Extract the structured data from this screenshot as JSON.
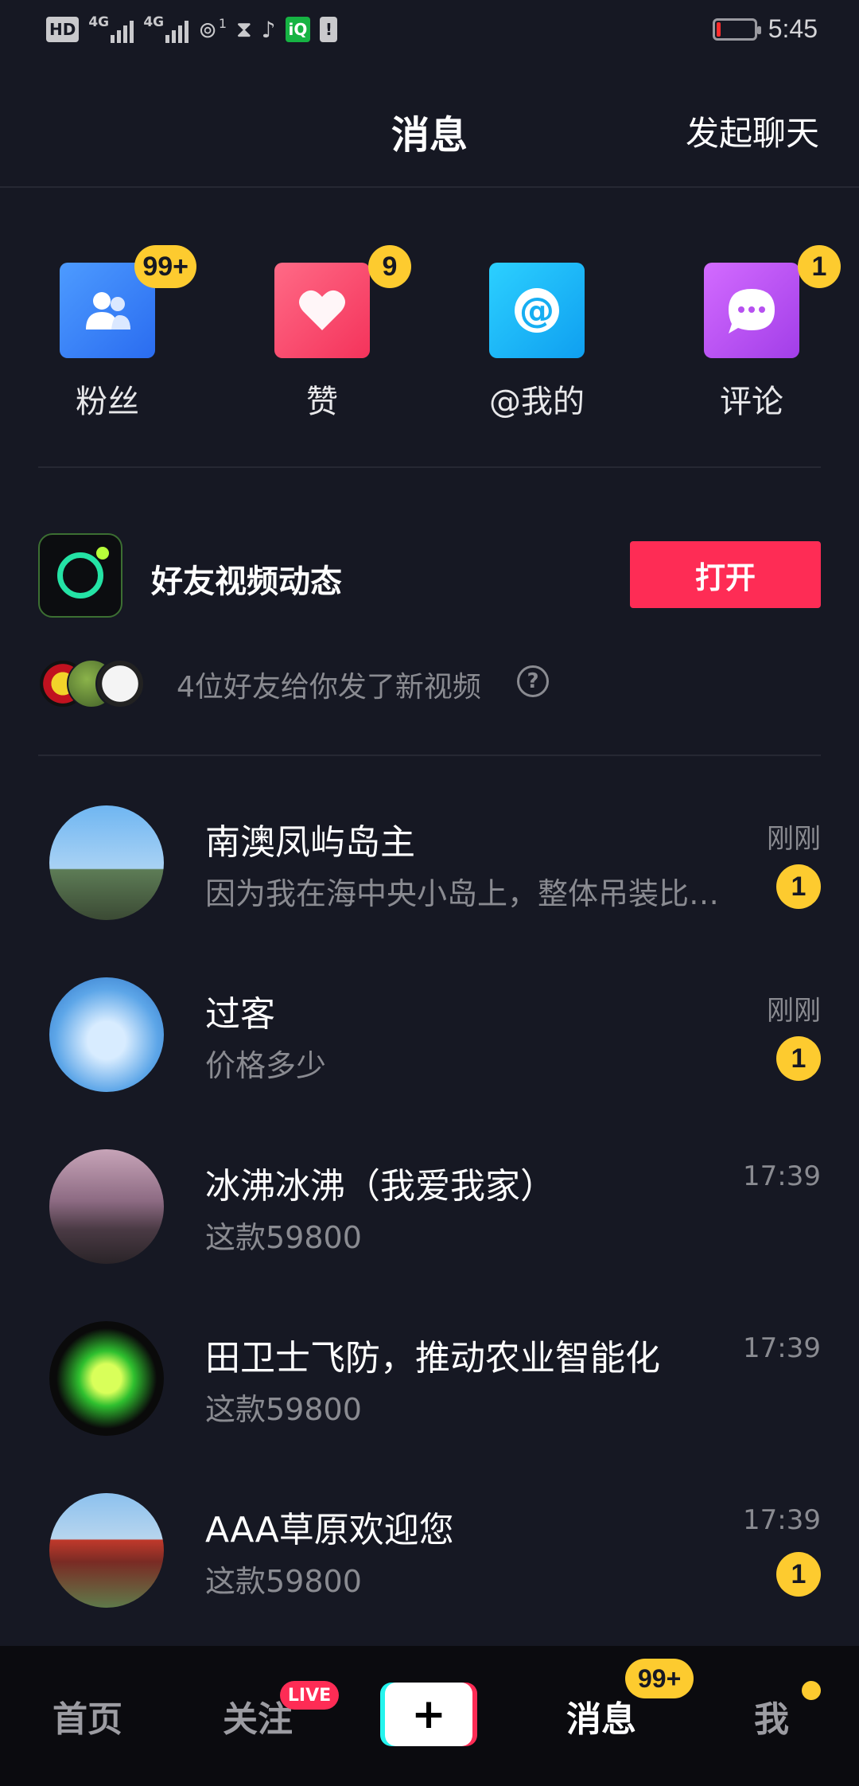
{
  "status_bar": {
    "hd": "HD",
    "net1": "4G",
    "net2": "4G",
    "hotspot_count": "1",
    "time": "5:45",
    "colors": {
      "battery_low": "#ff2d2d"
    }
  },
  "header": {
    "title": "消息",
    "action": "发起聊天"
  },
  "categories": [
    {
      "label": "粉丝",
      "badge": "99+",
      "icon": "fans-icon",
      "color": "#3a86f6"
    },
    {
      "label": "赞",
      "badge": "9",
      "icon": "heart-icon",
      "color": "#fd4a6e"
    },
    {
      "label": "@我的",
      "badge": "",
      "icon": "at-icon",
      "color": "#1ab5f5"
    },
    {
      "label": "评论",
      "badge": "1",
      "icon": "comment-icon",
      "color": "#b650f0"
    }
  ],
  "friends_video": {
    "title": "好友视频动态",
    "button": "打开",
    "subtitle": "4位好友给你发了新视频",
    "help": "?"
  },
  "conversations": [
    {
      "name": "南澳凤屿岛主",
      "preview": "因为我在海中央小岛上，整体吊装比…",
      "time": "刚刚",
      "unread": "1"
    },
    {
      "name": "过客",
      "preview": "价格多少",
      "time": "刚刚",
      "unread": "1"
    },
    {
      "name": "冰沸冰沸（我爱我家）",
      "preview": "这款59800",
      "time": "17:39",
      "unread": ""
    },
    {
      "name": "田卫士飞防，推动农业智能化",
      "preview": "这款59800",
      "time": "17:39",
      "unread": ""
    },
    {
      "name": "AAA草原欢迎您",
      "preview": "这款59800",
      "time": "17:39",
      "unread": "1"
    }
  ],
  "tabbar": {
    "home": "首页",
    "follow": "关注",
    "live": "LIVE",
    "plus": "+",
    "messages": "消息",
    "messages_badge": "99+",
    "me": "我"
  },
  "colors": {
    "background": "#161823",
    "accent": "#fe2c55",
    "badge": "#fdcb2f"
  }
}
